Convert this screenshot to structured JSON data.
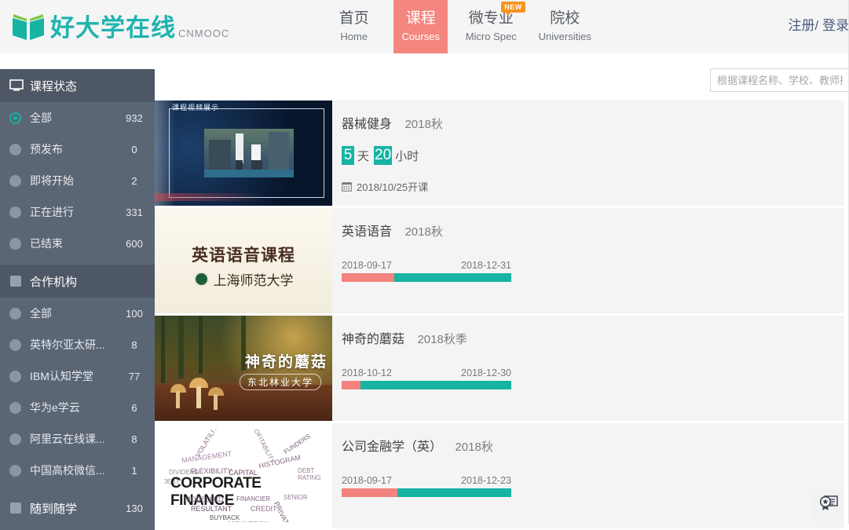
{
  "header": {
    "logo_text": "好大学在线",
    "logo_sub": "CNMOOC",
    "logo_icon": "open-book-icon",
    "auth_label": "注册/ 登录",
    "nav": [
      {
        "cn": "首页",
        "en": "Home",
        "active": false,
        "badge": ""
      },
      {
        "cn": "课程",
        "en": "Courses",
        "active": true,
        "badge": ""
      },
      {
        "cn": "微专业",
        "en": "Micro Spec",
        "active": false,
        "badge": "NEW"
      },
      {
        "cn": "院校",
        "en": "Universities",
        "active": false,
        "badge": ""
      }
    ]
  },
  "search": {
    "placeholder": "根据课程名称、学校、教师搜索",
    "value": ""
  },
  "sidebar": {
    "blocks": [
      {
        "title": "课程状态",
        "icon": "monitor-icon",
        "items": [
          {
            "label": "全部",
            "count": "932",
            "selected": true
          },
          {
            "label": "预发布",
            "count": "0",
            "selected": false
          },
          {
            "label": "即将开始",
            "count": "2",
            "selected": false
          },
          {
            "label": "正在进行",
            "count": "331",
            "selected": false
          },
          {
            "label": "已结束",
            "count": "600",
            "selected": false
          }
        ]
      },
      {
        "title": "合作机构",
        "icon": "square-icon",
        "items": [
          {
            "label": "全部",
            "count": "100",
            "selected": false
          },
          {
            "label": "英特尔亚太研...",
            "count": "8",
            "selected": false
          },
          {
            "label": "IBM认知学堂",
            "count": "77",
            "selected": false
          },
          {
            "label": "华为e学云",
            "count": "6",
            "selected": false
          },
          {
            "label": "阿里云在线课...",
            "count": "8",
            "selected": false
          },
          {
            "label": "中国高校微信...",
            "count": "1",
            "selected": false
          }
        ]
      },
      {
        "title": "随到随学",
        "icon": "square-icon",
        "count": "130",
        "items": []
      }
    ]
  },
  "courses": [
    {
      "title": "器械健身",
      "term": "2018秋",
      "type": "countdown",
      "countdown": {
        "days": "5",
        "days_unit": "天",
        "hours": "20",
        "hours_unit": "小时"
      },
      "start_text": "2018/10/25开课",
      "start_icon": "calendar-icon",
      "thumb": {
        "kind": "gym-video-thumbnail",
        "caption": "课程视频展示",
        "bg": "#0a1a35"
      }
    },
    {
      "title": "英语语音",
      "term": "2018秋",
      "type": "progress",
      "start_date": "2018-09-17",
      "end_date": "2018-12-31",
      "elapsed_pct": 31,
      "thumb": {
        "kind": "english-phonetics-thumbnail",
        "caption": "英语语音课程",
        "subcaption": "上海师范大学",
        "bg": "#f3efe4"
      }
    },
    {
      "title": "神奇的蘑菇",
      "term": "2018秋季",
      "type": "progress",
      "start_date": "2018-10-12",
      "end_date": "2018-12-30",
      "elapsed_pct": 11,
      "thumb": {
        "kind": "mushroom-forest-thumbnail",
        "caption": "神奇的蘑菇",
        "subcaption": "东北林业大学",
        "bg": "#3b3218"
      }
    },
    {
      "title": "公司金融学（英）",
      "term": "2018秋",
      "type": "progress",
      "start_date": "2018-09-17",
      "end_date": "2018-12-23",
      "elapsed_pct": 33,
      "thumb": {
        "kind": "corporate-finance-wordcloud-thumbnail",
        "caption": "CORPORATE FINANCE",
        "bg": "#ffffff"
      }
    }
  ],
  "float_button": {
    "icon": "certificate-badge-icon"
  },
  "colors": {
    "brand_teal": "#17b3a3",
    "accent_pink": "#f4827e",
    "sidebar_bg": "#5b6675",
    "sidebar_head_bg": "#4e5765",
    "badge_orange": "#f6921e",
    "card_bg": "#f4f4f4",
    "header_bg": "#f5f5f5"
  }
}
